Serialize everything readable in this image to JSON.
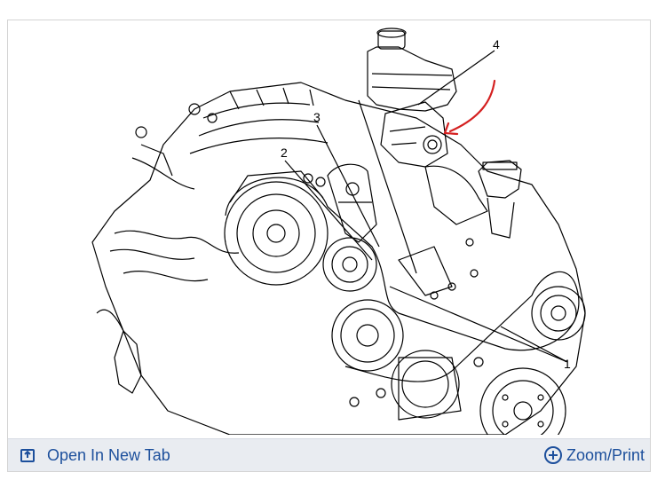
{
  "figure": {
    "callouts": [
      "1",
      "2",
      "3",
      "4"
    ]
  },
  "toolbar": {
    "open_label": "Open In New Tab",
    "zoom_label": "Zoom/Print"
  },
  "icons": {
    "open": "open-new-tab-icon",
    "zoom": "zoom-plus-icon"
  },
  "colors": {
    "link": "#1c4f9c",
    "bar_bg": "#e9ecf1",
    "annotation": "#d42020"
  }
}
